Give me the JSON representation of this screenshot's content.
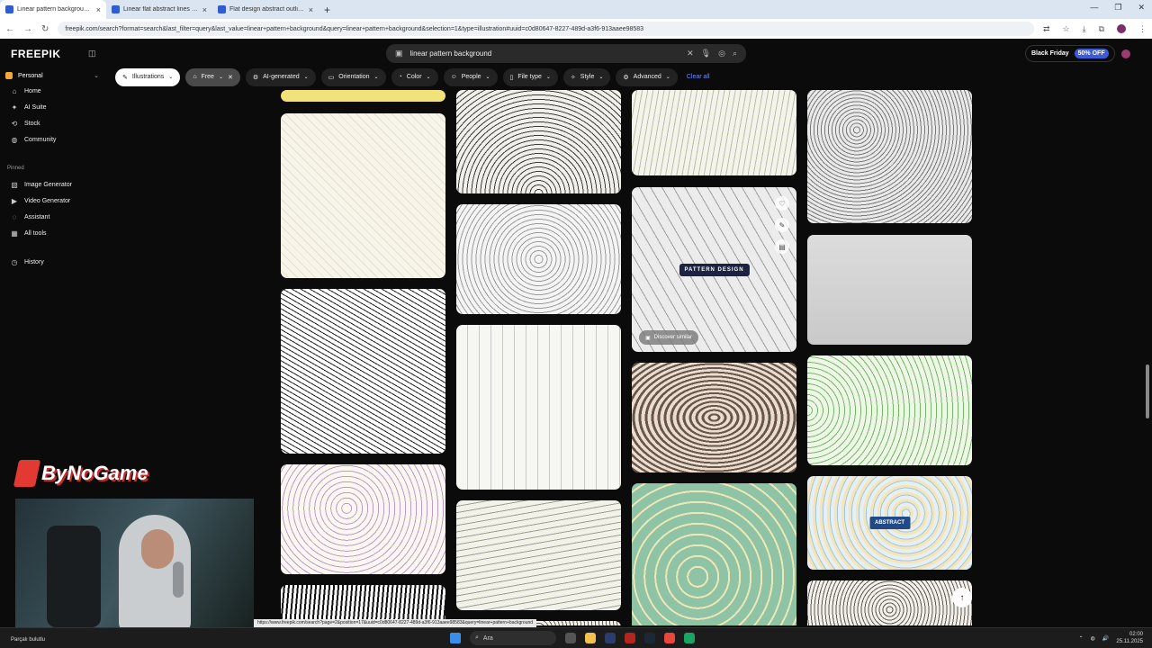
{
  "browser": {
    "tabs": [
      {
        "title": "Linear pattern background vec",
        "active": true
      },
      {
        "title": "Linear flat abstract lines patte",
        "active": false
      },
      {
        "title": "Flat design abstract outline ba",
        "active": false
      }
    ],
    "url": "freepik.com/search?format=search&last_filter=query&last_value=linear+pattern+background&query=linear+pattern+background&selection=1&type=illustration#uuid=c0d80647-8227-489d-a3f6-913aaee98583"
  },
  "header": {
    "logo": "FREEPIK",
    "search_query": "linear pattern background",
    "promo_label": "Black Friday",
    "promo_badge": "50% OFF"
  },
  "sidebar": {
    "workspace": "Personal",
    "items": [
      {
        "label": "Home",
        "icon": "home-icon"
      },
      {
        "label": "AI Suite",
        "icon": "sparkle-icon"
      },
      {
        "label": "Stock",
        "icon": "stock-icon"
      },
      {
        "label": "Community",
        "icon": "globe-icon"
      }
    ],
    "pinned_heading": "Pinned",
    "pinned": [
      {
        "label": "Image Generator",
        "icon": "image-icon"
      },
      {
        "label": "Video Generator",
        "icon": "video-icon"
      },
      {
        "label": "Assistant",
        "icon": "assistant-icon"
      },
      {
        "label": "All tools",
        "icon": "grid-icon"
      }
    ],
    "history": "History"
  },
  "filters": {
    "illustrations": "Illustrations",
    "free": "Free",
    "ai_generated": "AI-generated",
    "orientation": "Orientation",
    "color": "Color",
    "people": "People",
    "file_type": "File type",
    "style": "Style",
    "advanced": "Advanced",
    "clear_all": "Clear all"
  },
  "cards": {
    "pattern_design_label": "PATTERN DESIGN",
    "abstract_label": "ABSTRACT",
    "discover_similar": "Discover similar"
  },
  "overlay": {
    "brand": "ByNoGame"
  },
  "status": {
    "link_preview": "https://www.freepik.com/search?page=2&position=17&uuid=c0d80647-8227-489d-a3f6-913aaee98583&query=linear+pattern+background",
    "left_text": "Parçalı bulutlu"
  },
  "taskbar": {
    "search_label": "Ara",
    "time": "02:00",
    "date": "25.11.2025"
  }
}
